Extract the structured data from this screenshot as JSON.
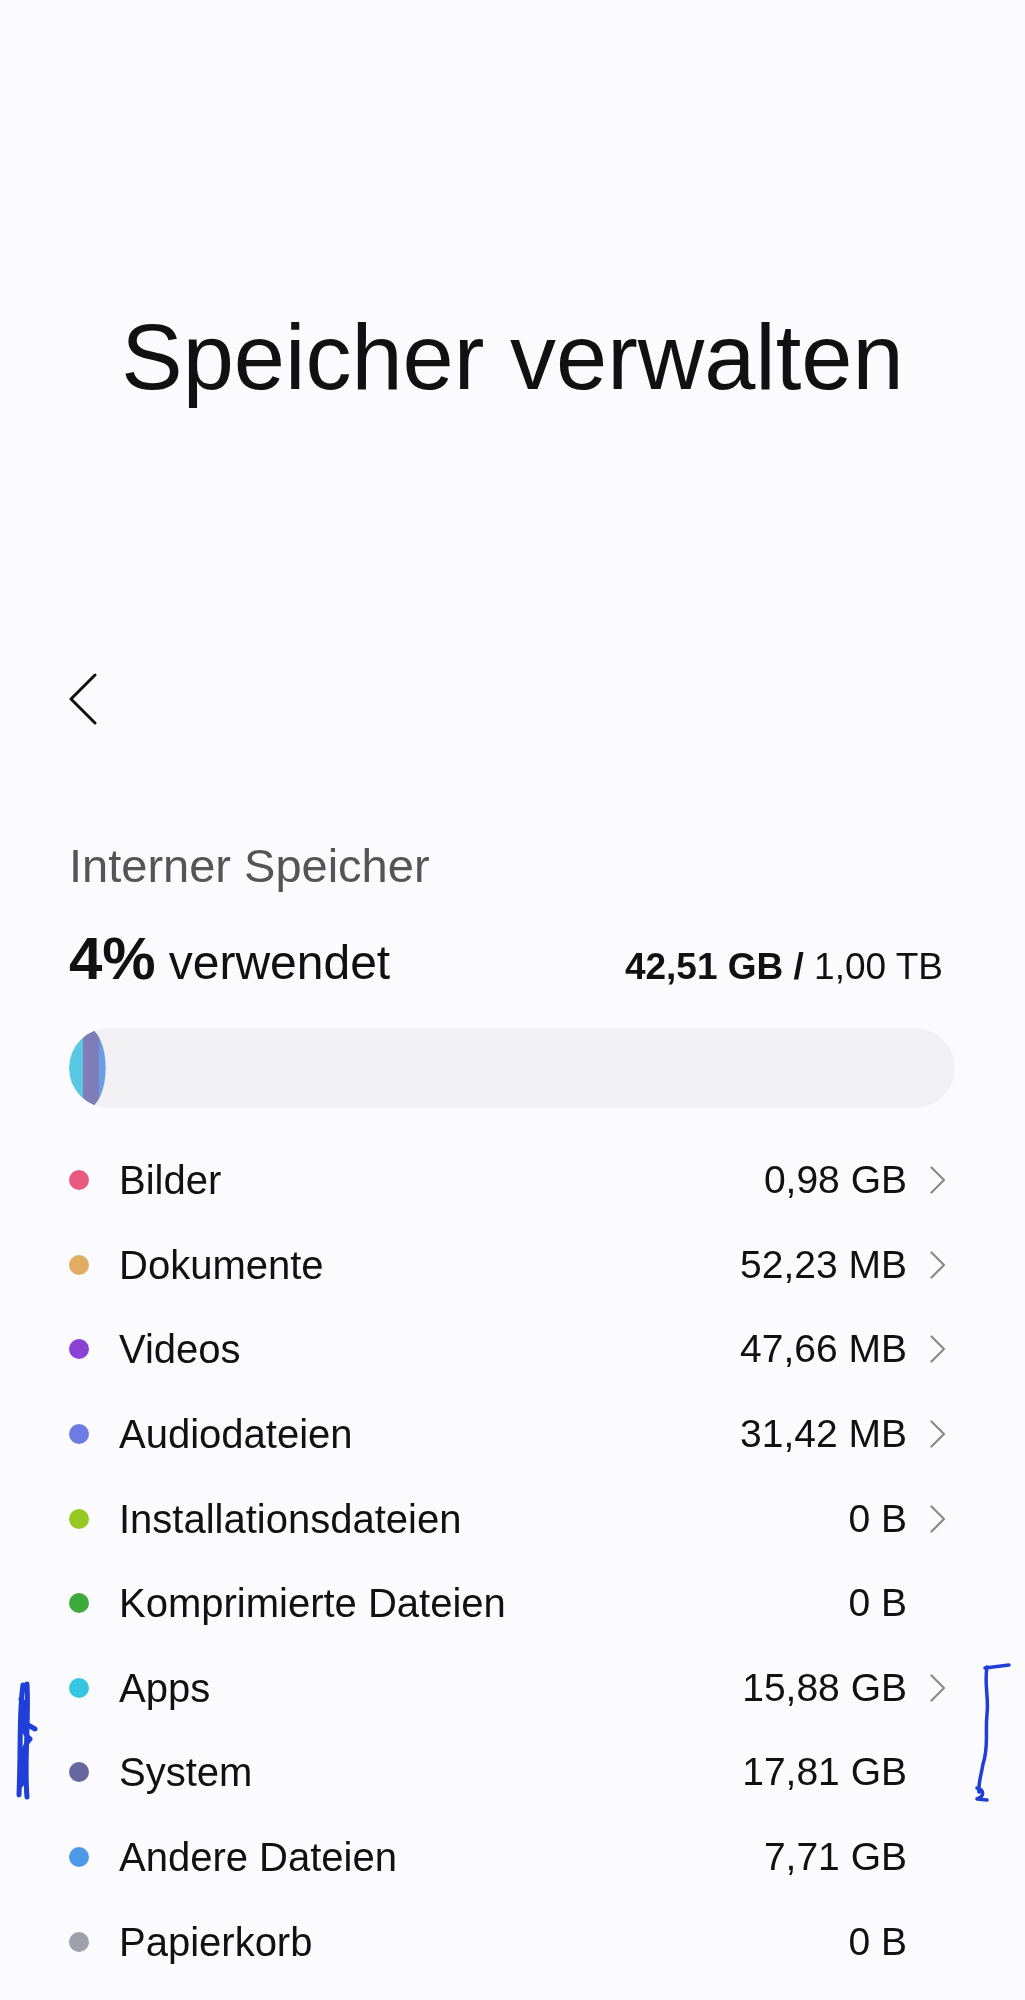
{
  "screen": {
    "title": "Speicher verwalten"
  },
  "storage": {
    "heading": "Interner Speicher",
    "percent": "4%",
    "percent_label": "verwendet",
    "usage": "**42,51 GB /** 1,00 TB",
    "segments": [
      {
        "color": "#5bc8e3",
        "level": 0.0159
      },
      {
        "color": "#7f7db8",
        "level": 0.0178
      },
      {
        "color": "#6b9de6",
        "level": 0.0077
      }
    ]
  },
  "categories": [
    {
      "name": "Bilder",
      "size": "0,98 GB",
      "color": "#e8587f",
      "has_details": true
    },
    {
      "name": "Dokumente",
      "size": "52,23 MB",
      "color": "#e0ad62",
      "has_details": true
    },
    {
      "name": "Videos",
      "size": "47,66 MB",
      "color": "#8b40d6",
      "has_details": true
    },
    {
      "name": "Audiodateien",
      "size": "31,42 MB",
      "color": "#6e7ce2",
      "has_details": true
    },
    {
      "name": "Installationsdateien",
      "size": "0 B",
      "color": "#98c822",
      "has_details": true
    },
    {
      "name": "Komprimierte Dateien",
      "size": "0 B",
      "color": "#3faa3c",
      "has_details": false
    },
    {
      "name": "Apps",
      "size": "15,88 GB",
      "color": "#37c6e2",
      "has_details": true
    },
    {
      "name": "System",
      "size": "17,81 GB",
      "color": "#67679f",
      "has_details": false
    },
    {
      "name": "Andere Dateien",
      "size": "7,71 GB",
      "color": "#4d9ae8",
      "has_details": false
    },
    {
      "name": "Papierkorb",
      "size": "0 B",
      "color": "#a0a0ac",
      "has_details": false
    }
  ]
}
